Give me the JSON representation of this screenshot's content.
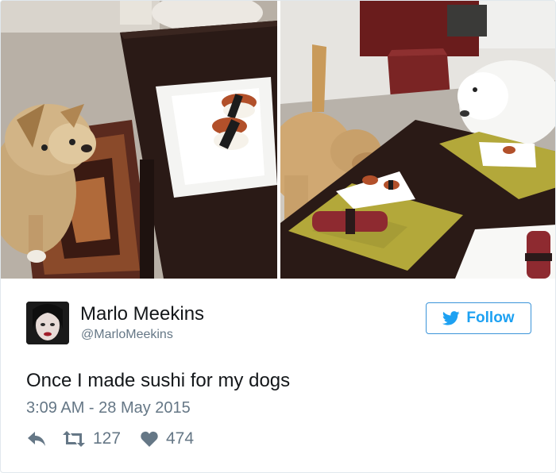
{
  "tweet": {
    "author": {
      "display_name": "Marlo Meekins",
      "handle": "@MarloMeekins"
    },
    "follow_label": "Follow",
    "text": "Once I made sushi for my dogs",
    "timestamp": "3:09 AM - 28 May 2015",
    "stats": {
      "retweets": "127",
      "likes": "474"
    }
  },
  "colors": {
    "accent": "#1da1f2",
    "muted": "#657786",
    "text": "#14171a",
    "border": "#e1e8ed"
  },
  "icons": {
    "follow": "twitter-bird-icon",
    "reply": "reply-arrow-icon",
    "retweet": "retweet-icon",
    "like": "heart-icon"
  }
}
